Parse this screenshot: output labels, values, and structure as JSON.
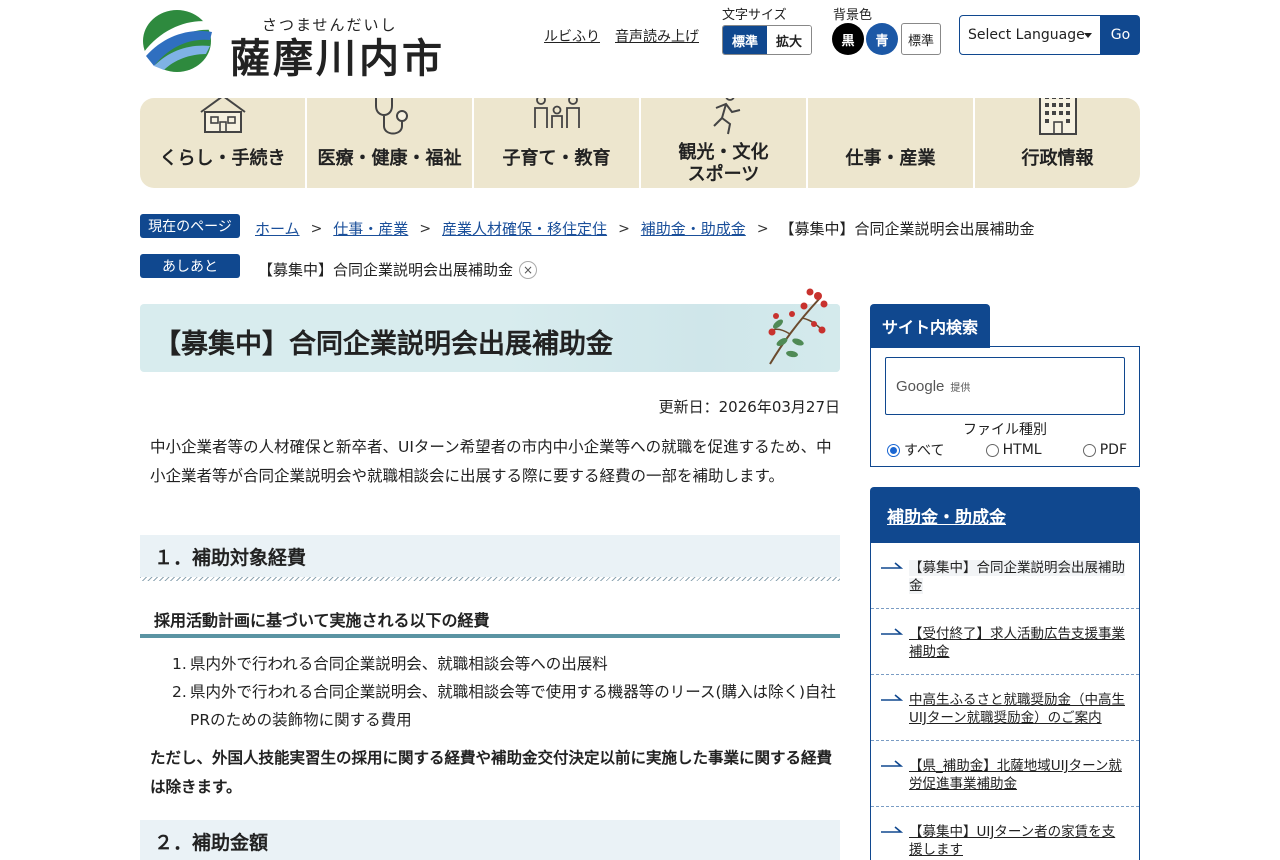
{
  "header": {
    "logo_ruby": "さつませんだいし",
    "logo_name": "薩摩川内市",
    "ruby_link": "ルビふり",
    "voice_link": "音声読み上げ",
    "font_size_label": "文字サイズ",
    "font_standard": "標準",
    "font_large": "拡大",
    "bg_label": "背景色",
    "bg_black": "黒",
    "bg_blue": "青",
    "bg_standard": "標準",
    "language_select": "Select Language",
    "go_button": "Go"
  },
  "nav": [
    {
      "label": "くらし・手続き",
      "icon": "house-icon"
    },
    {
      "label": "医療・健康・福祉",
      "icon": "stethoscope-icon"
    },
    {
      "label": "子育て・教育",
      "icon": "family-icon"
    },
    {
      "label_line1": "観光・文化",
      "label_line2": "スポーツ",
      "icon": "running-icon"
    },
    {
      "label": "仕事・産業",
      "icon": "none"
    },
    {
      "label": "行政情報",
      "icon": "building-icon"
    }
  ],
  "breadcrumb": {
    "tag": "現在のページ",
    "items": [
      "ホーム",
      "仕事・産業",
      "産業人材確保・移住定住",
      "補助金・助成金"
    ],
    "current": "【募集中】合同企業説明会出展補助金"
  },
  "trail": {
    "tag": "あしあと",
    "item": "【募集中】合同企業説明会出展補助金",
    "close": "×"
  },
  "main": {
    "title": "【募集中】合同企業説明会出展補助金",
    "updated": "更新日：2026年03月27日",
    "lead": "中小企業者等の人材確保と新卒者、UIターン希望者の市内中小企業等への就職を促進するため、中小企業者等が合同企業説明会や就職相談会に出展する際に要する経費の一部を補助します。",
    "section1": "１．補助対象経費",
    "subsection1": "採用活動計画に基づいて実施される以下の経費",
    "list": [
      {
        "num": "1.",
        "text": "県内外で行われる合同企業説明会、就職相談会等への出展料"
      },
      {
        "num": "2.",
        "text": "県内外で行われる合同企業説明会、就職相談会等で使用する機器等のリース(購入は除く)自社PRのための装飾物に関する費用"
      }
    ],
    "note": "ただし、外国人技能実習生の採用に関する経費や補助金交付決定以前に実施した事業に関する経費は除きます。",
    "section2": "２．補助金額"
  },
  "side": {
    "search_tab": "サイト内検索",
    "google": "Google",
    "provided": "提供",
    "file_type": "ファイル種別",
    "radios": [
      "すべて",
      "HTML",
      "PDF"
    ],
    "selected_radio": "すべて",
    "category": "補助金・助成金",
    "links": [
      "【募集中】合同企業説明会出展補助金",
      "【受付終了】求人活動広告支援事業補助金",
      "中高生ふるさと就職奨励金（中高生UIJターン就職奨励金）のご案内",
      "【県_補助金】北薩地域UIJターン就労促進事業補助金",
      "【募集中】UIJターン者の家賃を支援します"
    ]
  },
  "colors": {
    "brand_blue": "#10488f",
    "nav_bg": "#ede6ce",
    "title_bg": "#d8ecee",
    "section_rule": "#5b94a3"
  }
}
